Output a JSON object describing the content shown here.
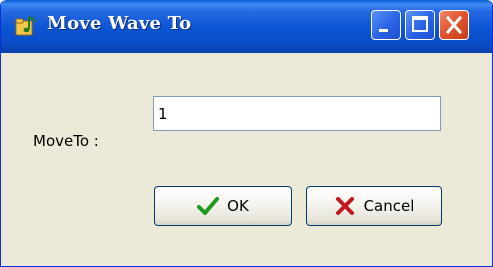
{
  "window": {
    "title": "Move Wave To",
    "icon": "music-note-folder-icon",
    "controls": {
      "minimize": "minimize-icon",
      "maximize": "maximize-icon",
      "close": "close-icon"
    }
  },
  "form": {
    "label": "MoveTo :",
    "input_value": "1"
  },
  "buttons": {
    "ok_label": "OK",
    "ok_icon": "checkmark-icon",
    "cancel_label": "Cancel",
    "cancel_icon": "x-icon"
  },
  "colors": {
    "titlebar": "#0a54d2",
    "face": "#ece9d8",
    "close": "#e0522a",
    "ok_check": "#1e9a1e",
    "cancel_x": "#c0181c"
  }
}
